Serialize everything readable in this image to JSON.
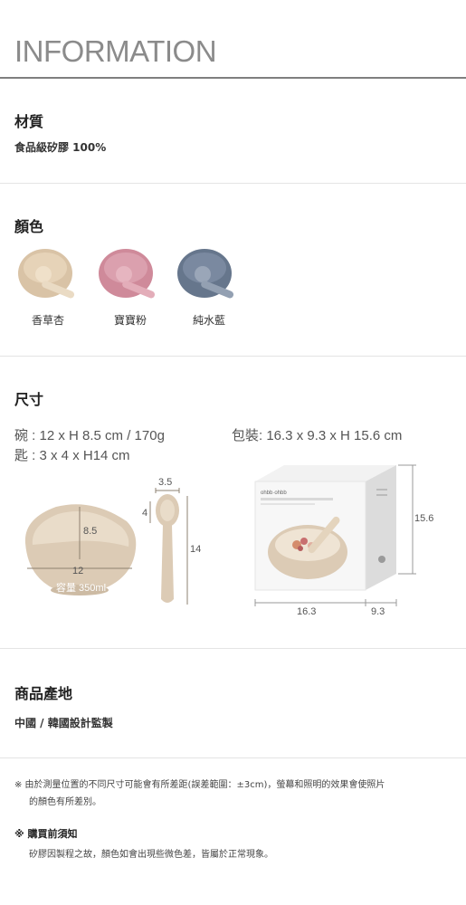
{
  "header": {
    "title": "INFORMATION"
  },
  "material": {
    "heading": "材質",
    "value": "食品級矽膠 100%"
  },
  "colors": {
    "heading": "顏色",
    "items": [
      {
        "name": "香草杏",
        "bowl": "#d9c3a6",
        "spoon": "#e8d5bb"
      },
      {
        "name": "寶寶粉",
        "bowl": "#cf8a9a",
        "spoon": "#e0a9b5"
      },
      {
        "name": "純水藍",
        "bowl": "#66768c",
        "spoon": "#8a98ab"
      }
    ]
  },
  "size": {
    "heading": "尺寸",
    "bowl_spec": "碗 : 12 x H 8.5 cm / 170g",
    "spoon_spec": "匙 : 3 x 4 x H14 cm",
    "package_spec": "包裝: 16.3 x 9.3 x H 15.6 cm",
    "bowl_height": "8.5",
    "bowl_width": "12",
    "bowl_capacity": "容量 350ml",
    "spoon_width": "3.5",
    "spoon_depth": "4",
    "spoon_length": "14",
    "box_height": "15.6",
    "box_width": "16.3",
    "box_depth": "9.3",
    "box_brand": "ohbb·ohbb"
  },
  "origin": {
    "heading": "商品產地",
    "value": "中國 / 韓國設計監製"
  },
  "notes": {
    "line1": "※ 由於測量位置的不同尺寸可能會有所差距(誤差範圍：±3cm)，螢幕和照明的效果會使照片",
    "line2": "的顏色有所差別。",
    "purchase_heading": "※ 購買前須知",
    "purchase_body": "矽膠因製程之故，顏色如會出現些微色差，皆屬於正常現象。"
  }
}
